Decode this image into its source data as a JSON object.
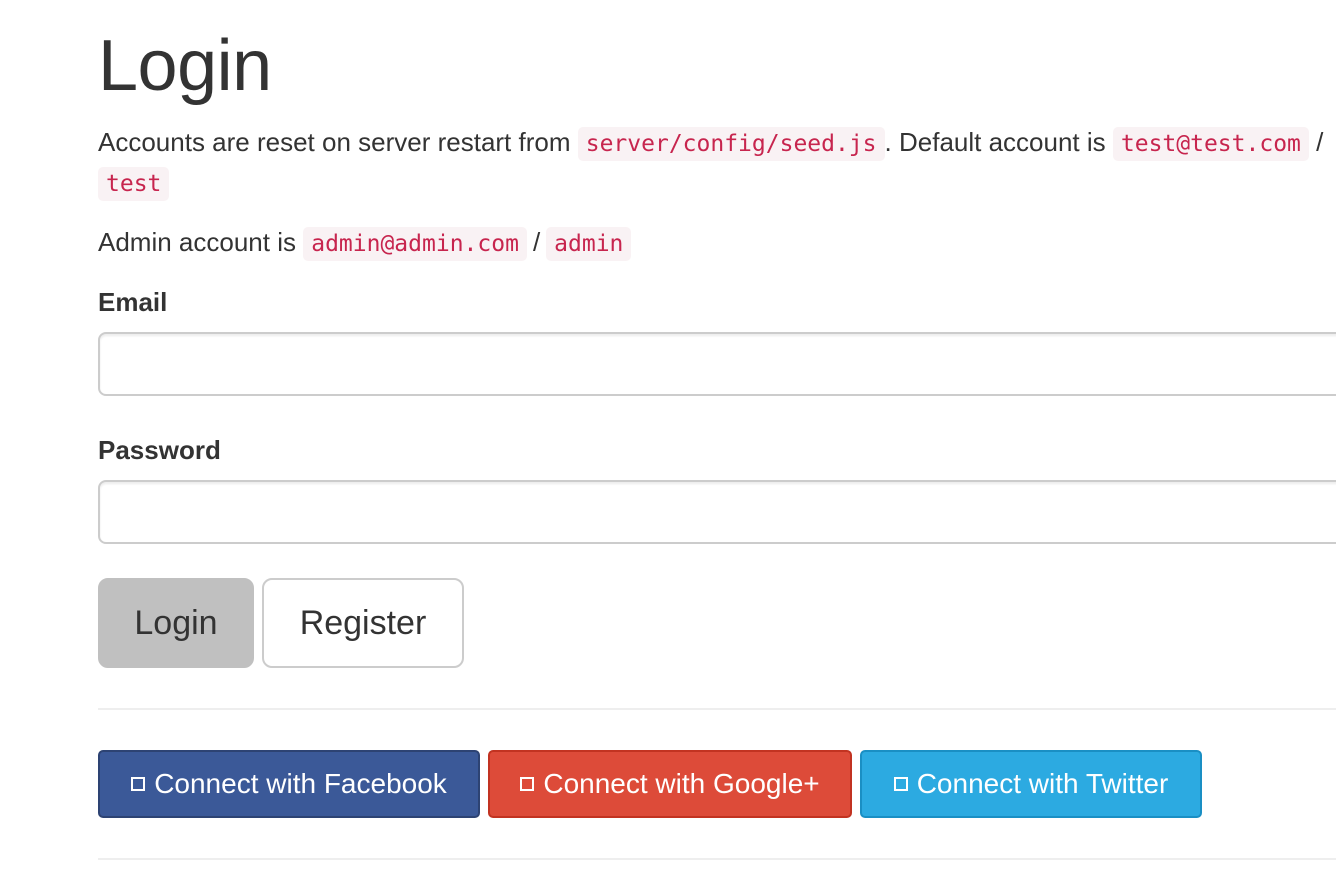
{
  "page": {
    "title": "Login"
  },
  "info": {
    "line1_prefix": "Accounts are reset on server restart from ",
    "seed_file": "server/config/seed.js",
    "line1_middle": ". Default account is ",
    "default_email": "test@test.com",
    "line1_sep": " / ",
    "default_password": "test",
    "admin_prefix": "Admin account is ",
    "admin_email": "admin@admin.com",
    "admin_sep": "/",
    "admin_password": "admin"
  },
  "form": {
    "email_label": "Email",
    "email_value": "",
    "password_label": "Password",
    "password_value": "",
    "login_label": "Login",
    "register_label": "Register"
  },
  "social": {
    "facebook_label": "Connect with Facebook",
    "google_label": "Connect with Google+",
    "twitter_label": "Connect with Twitter"
  },
  "colors": {
    "facebook": "#3b5998",
    "google": "#dd4b39",
    "twitter": "#2caae1",
    "code_text": "#c7254e",
    "code_bg": "#f9f2f4"
  }
}
